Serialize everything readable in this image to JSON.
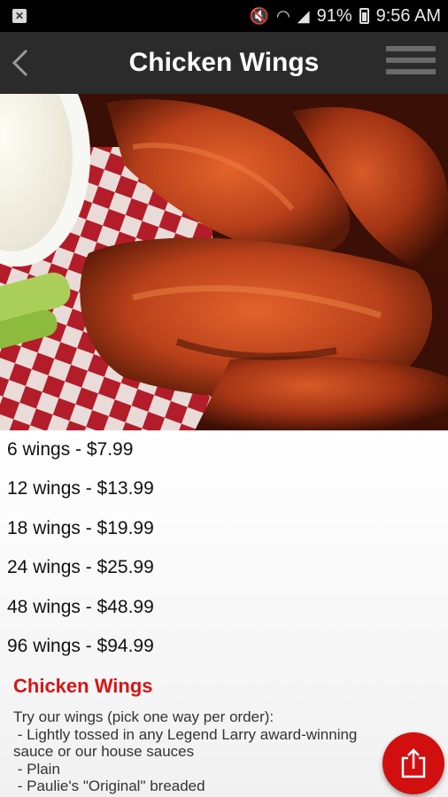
{
  "status_bar": {
    "battery": "91%",
    "time": "9:56 AM"
  },
  "header": {
    "title": "Chicken Wings"
  },
  "prices": [
    "6 wings - $7.99",
    "12 wings - $13.99",
    "18 wings - $19.99",
    "24 wings - $25.99",
    "48 wings - $48.99",
    "96 wings - $94.99"
  ],
  "section": {
    "title": "Chicken Wings",
    "description": "Try our wings (pick one way per order):\n - Lightly tossed in any Legend Larry award-winning\nsauce or our house sauces\n - Plain\n - Paulie's \"Original\" breaded"
  },
  "colors": {
    "accent": "#d41616",
    "app_bar": "#2b2b2b"
  }
}
